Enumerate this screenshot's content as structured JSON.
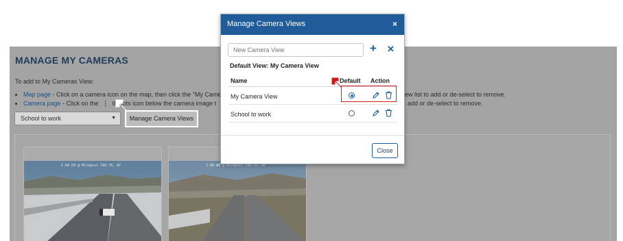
{
  "page": {
    "title": "MANAGE MY CAMERAS",
    "intro": "To add to My Cameras View:",
    "bullet1_link": "Map page",
    "bullet1_text": " - Click on a camera icon on the map, then click the \"My Came",
    "bullet1_right": "ew list to add or de-select to remove.",
    "bullet2_link": "Camera page",
    "bullet2_text_a": " - Click on the ",
    "bullet2_kebab": "⋮",
    "bullet2_text_b": " th",
    "bullet2_text_c": " dots icon below the camera image t",
    "bullet2_right": " add or de-select to remove.",
    "view_select_value": "School to work",
    "manage_button": "Manage Camera Views",
    "cameras": [
      {
        "label": "I-80 EB @ Milepost 186.76, WY"
      },
      {
        "label": "I-80 WB @ Milepost 186.76, WY"
      }
    ]
  },
  "modal": {
    "title": "Manage Camera Views",
    "close_glyph": "×",
    "new_view_placeholder": "New Camera View",
    "add_glyph": "+",
    "clear_glyph": "✕",
    "default_view_label": "Default View: My Camera View",
    "columns": {
      "name": "Name",
      "default": "Default",
      "action": "Action"
    },
    "rows": [
      {
        "name": "My Camera View",
        "default": true
      },
      {
        "name": "School to work",
        "default": false
      }
    ],
    "close_button": "Close"
  },
  "colors": {
    "header_blue": "#1f5c99",
    "highlight_red": "#d11f1f",
    "overlay_gray": "#a4a4a4"
  }
}
